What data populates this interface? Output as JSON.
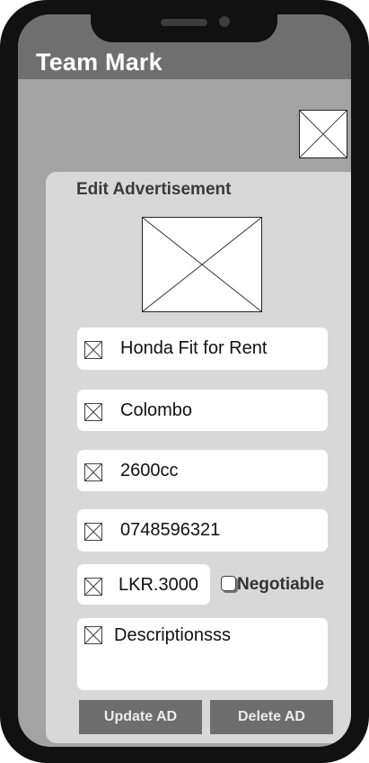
{
  "header": {
    "title": "Team Mark"
  },
  "form": {
    "title": "Edit Advertisement",
    "fields": {
      "title": "Honda Fit for Rent",
      "location": "Colombo",
      "engine": "2600cc",
      "phone": "0748596321",
      "price": "LKR.3000",
      "description": "Descriptionsss"
    },
    "negotiable_label": "Negotiable",
    "negotiable_checked": false,
    "update_button": "Update AD",
    "delete_button": "Delete AD"
  }
}
